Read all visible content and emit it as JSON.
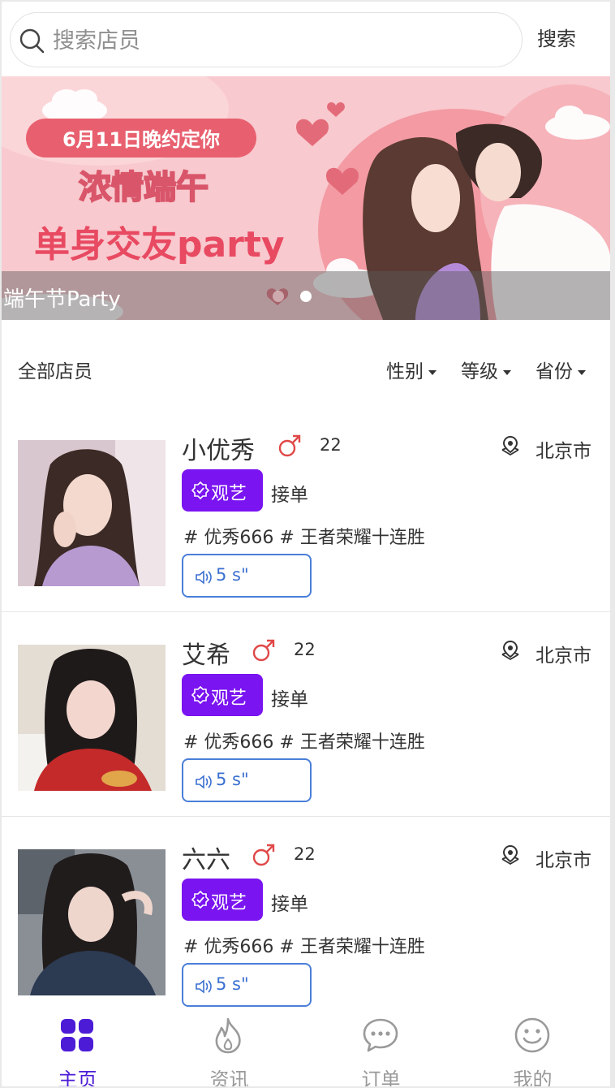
{
  "search": {
    "placeholder": "搜索店员",
    "button_label": "搜索"
  },
  "banner": {
    "caption": "端午节Party",
    "art_lines": [
      "6月11日晚约定你",
      "浓情端午",
      "单身交友party"
    ],
    "slide_count": 2,
    "active_slide": 2
  },
  "filter": {
    "all_label": "全部店员",
    "options": [
      "性别",
      "等级",
      "省份"
    ]
  },
  "staff": [
    {
      "name": "小优秀",
      "gender_icon": "male-symbol-icon",
      "age": "22",
      "location": "北京市",
      "badge": "观艺",
      "status": "接单",
      "tags": "# 优秀666 # 王者荣耀十连胜",
      "voice": "5 s\""
    },
    {
      "name": "艾希",
      "gender_icon": "male-symbol-icon",
      "age": "22",
      "location": "北京市",
      "badge": "观艺",
      "status": "接单",
      "tags": "# 优秀666 # 王者荣耀十连胜",
      "voice": "5 s\""
    },
    {
      "name": "六六",
      "gender_icon": "male-symbol-icon",
      "age": "22",
      "location": "北京市",
      "badge": "观艺",
      "status": "接单",
      "tags": "# 优秀666 # 王者荣耀十连胜",
      "voice": "5 s\""
    }
  ],
  "tabbar": {
    "items": [
      {
        "label": "主页",
        "icon": "grid-icon",
        "active": true
      },
      {
        "label": "资讯",
        "icon": "flame-icon",
        "active": false
      },
      {
        "label": "订单",
        "icon": "chat-icon",
        "active": false
      },
      {
        "label": "我的",
        "icon": "smile-icon",
        "active": false
      }
    ]
  },
  "colors": {
    "accent": "#4b1bd6",
    "badge": "#7a14f0",
    "voice_border": "#4a7fd8",
    "male_icon": "#e04848",
    "banner_pink": "#f7c7cc"
  }
}
